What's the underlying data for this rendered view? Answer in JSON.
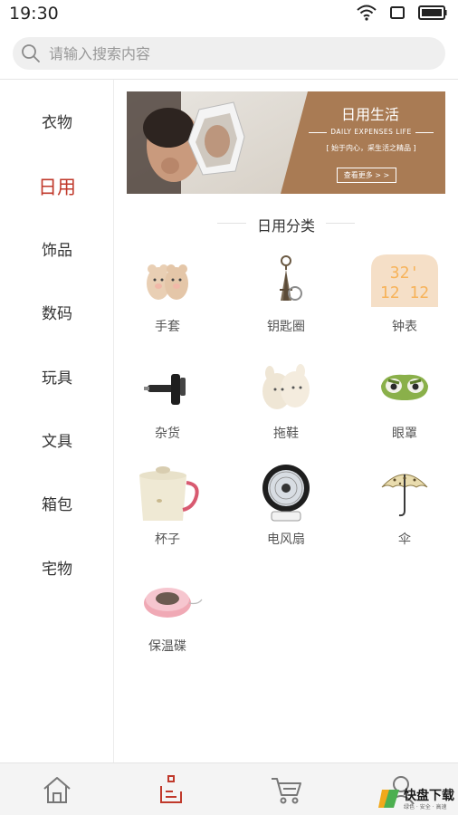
{
  "status_bar": {
    "time": "19:30"
  },
  "search": {
    "placeholder": "请输入搜索内容",
    "value": ""
  },
  "sidebar": {
    "items": [
      {
        "label": "衣物",
        "active": false
      },
      {
        "label": "日用",
        "active": true
      },
      {
        "label": "饰品",
        "active": false
      },
      {
        "label": "数码",
        "active": false
      },
      {
        "label": "玩具",
        "active": false
      },
      {
        "label": "文具",
        "active": false
      },
      {
        "label": "箱包",
        "active": false
      },
      {
        "label": "宅物",
        "active": false
      }
    ]
  },
  "banner": {
    "title": "日用生活",
    "subtitle": "DAILY EXPENSES   LIFE",
    "tagline": "[ 始于内心，采生活之精品 ]",
    "button": "查看更多 > >"
  },
  "section": {
    "title": "日用分类"
  },
  "categories": [
    {
      "label": "手套",
      "icon": "gloves-icon"
    },
    {
      "label": "钥匙圈",
      "icon": "keychain-icon"
    },
    {
      "label": "钟表",
      "icon": "clock-icon"
    },
    {
      "label": "杂货",
      "icon": "sundries-icon"
    },
    {
      "label": "拖鞋",
      "icon": "slippers-icon"
    },
    {
      "label": "眼罩",
      "icon": "eye-mask-icon"
    },
    {
      "label": "杯子",
      "icon": "cup-icon"
    },
    {
      "label": "电风扇",
      "icon": "fan-icon"
    },
    {
      "label": "伞",
      "icon": "umbrella-icon"
    },
    {
      "label": "保温碟",
      "icon": "warming-plate-icon"
    }
  ],
  "bottom_nav": [
    {
      "name": "home",
      "icon": "home-icon",
      "active": false
    },
    {
      "name": "category",
      "icon": "category-icon",
      "active": true
    },
    {
      "name": "cart",
      "icon": "cart-icon",
      "active": false
    },
    {
      "name": "profile",
      "icon": "profile-icon",
      "active": false
    }
  ],
  "watermark": {
    "brand": "快盘下载",
    "small": "绿色 · 安全 · 高速"
  },
  "colors": {
    "accent": "#c0392b",
    "banner": "#a97b54",
    "text": "#333333",
    "muted": "#999999"
  }
}
